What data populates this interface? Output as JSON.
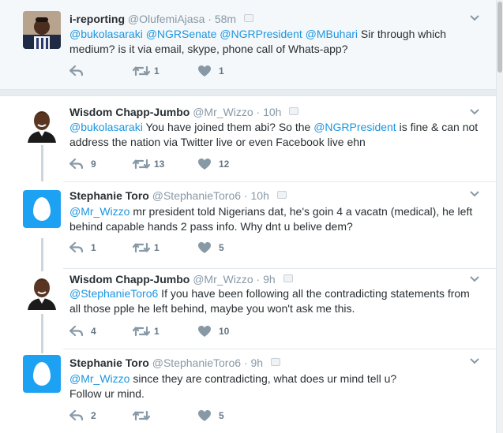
{
  "tweets": [
    {
      "name": "i-reporting",
      "handle": "@OlufemiAjasa",
      "time": "58m",
      "segments": [
        {
          "t": "@bukolasaraki",
          "m": true
        },
        {
          "t": " ",
          "m": false
        },
        {
          "t": "@NGRSenate",
          "m": true
        },
        {
          "t": " ",
          "m": false
        },
        {
          "t": "@NGRPresident",
          "m": true
        },
        {
          "t": " ",
          "m": false
        },
        {
          "t": "@MBuhari",
          "m": true
        },
        {
          "t": " Sir through which medium? is it via email, skype, phone call of Whats-app?",
          "m": false
        }
      ],
      "retweets": "1",
      "likes": "1",
      "replies": ""
    },
    {
      "name": "Wisdom Chapp-Jumbo",
      "handle": "@Mr_Wizzo",
      "time": "10h",
      "segments": [
        {
          "t": "@bukolasaraki",
          "m": true
        },
        {
          "t": " You have joined them abi? So the ",
          "m": false
        },
        {
          "t": "@NGRPresident",
          "m": true
        },
        {
          "t": " is fine & can not address the nation via Twitter live or even Facebook live ehn",
          "m": false
        }
      ],
      "replies": "9",
      "retweets": "13",
      "likes": "12"
    },
    {
      "name": "Stephanie Toro",
      "handle": "@StephanieToro6",
      "time": "10h",
      "segments": [
        {
          "t": "@Mr_Wizzo",
          "m": true
        },
        {
          "t": " mr president told Nigerians  dat, he's goin 4 a vacatn (medical), he left behind capable hands 2 pass info. Why dnt u belive dem?",
          "m": false
        }
      ],
      "replies": "1",
      "retweets": "1",
      "likes": "5"
    },
    {
      "name": "Wisdom Chapp-Jumbo",
      "handle": "@Mr_Wizzo",
      "time": "9h",
      "segments": [
        {
          "t": "@StephanieToro6",
          "m": true
        },
        {
          "t": " If you have been following all the contradicting statements from all those pple he left behind, maybe you won't ask me this.",
          "m": false
        }
      ],
      "replies": "4",
      "retweets": "1",
      "likes": "10"
    },
    {
      "name": "Stephanie Toro",
      "handle": "@StephanieToro6",
      "time": "9h",
      "segments": [
        {
          "t": "@Mr_Wizzo",
          "m": true
        },
        {
          "t": " since they are contradicting, what does ur mind tell u?\nFollow ur mind.",
          "m": false
        }
      ],
      "replies": "2",
      "retweets": "",
      "likes": "5"
    }
  ],
  "dot": "·",
  "colors": {
    "mention": "#1b95e0",
    "egg_background": "#1da1f2",
    "muted": "#8899a6"
  },
  "icons": [
    "reply-icon",
    "retweet-icon",
    "like-icon",
    "caret-down-icon",
    "verified-badge"
  ]
}
